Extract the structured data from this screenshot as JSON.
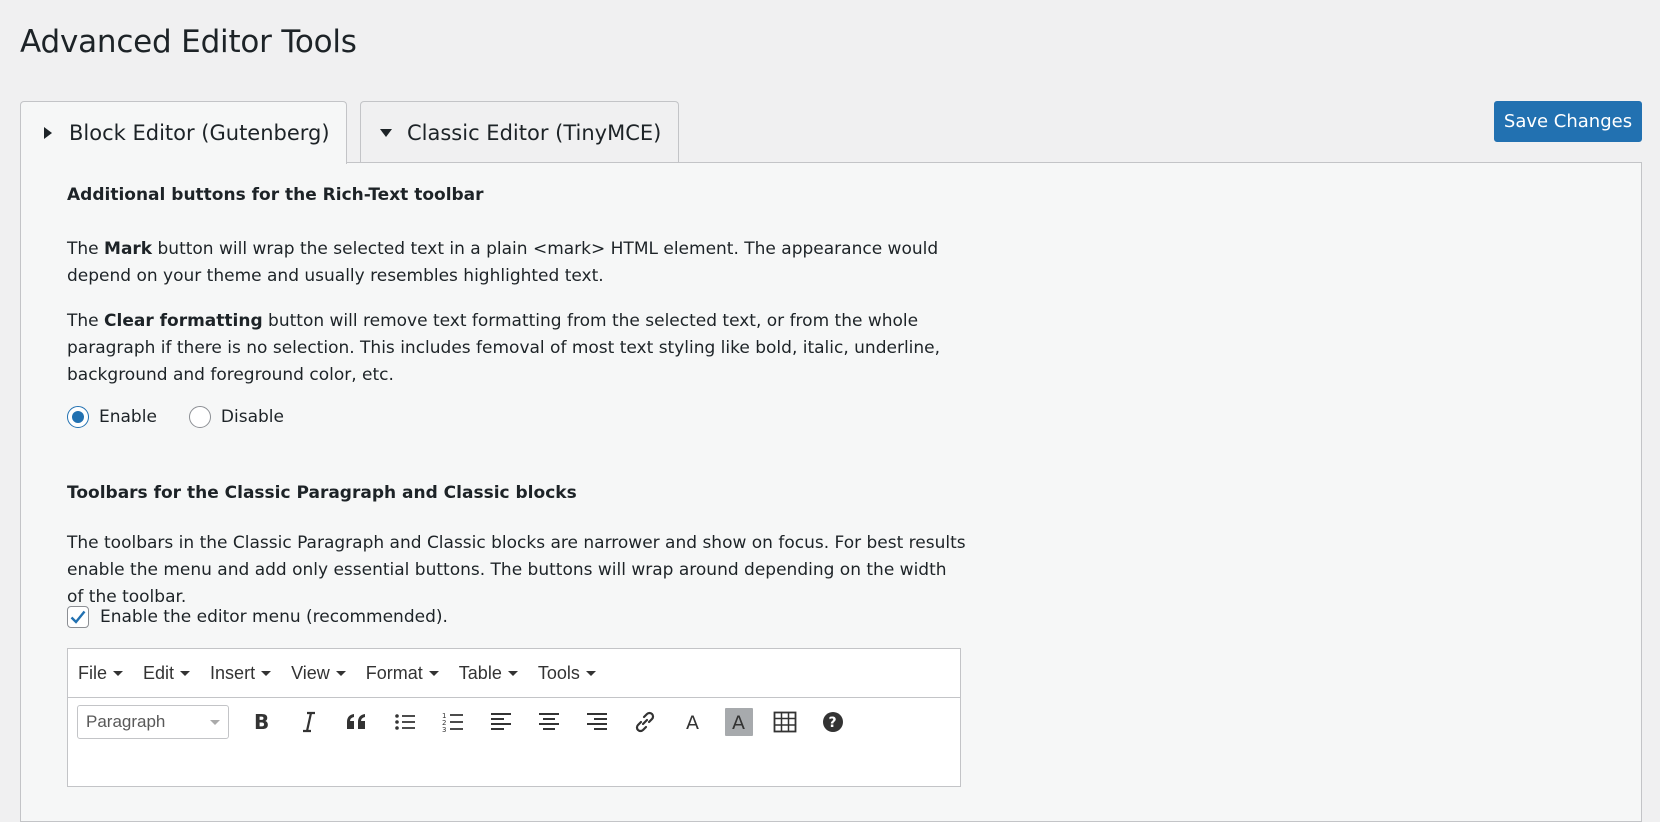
{
  "page_title": "Advanced Editor Tools",
  "tabs": [
    {
      "label": "Block Editor (Gutenberg)",
      "active": true
    },
    {
      "label": "Classic Editor (TinyMCE)",
      "active": false
    }
  ],
  "save_label": "Save Changes",
  "section1": {
    "heading": "Additional buttons for the Rich-Text toolbar",
    "p1": {
      "pre": "The ",
      "bold": "Mark",
      "post": " button will wrap the selected text in a plain <mark> HTML element. The appearance would depend on your theme and usually resembles highlighted text."
    },
    "p2": {
      "pre": "The ",
      "bold": "Clear formatting",
      "post": " button will remove text formatting from the selected text, or from the whole paragraph if there is no selection. This includes femoval of most text styling like bold, italic, underline, background and foreground color, etc."
    },
    "radio_enable": "Enable",
    "radio_disable": "Disable",
    "selected": "Enable"
  },
  "section2": {
    "heading": "Toolbars for the Classic Paragraph and Classic blocks",
    "p1": "The toolbars in the Classic Paragraph and Classic blocks are narrower and show on focus. For best results enable the menu and add only essential buttons. The buttons will wrap around depending on the width of the toolbar.",
    "checkbox_label": "Enable the editor menu (recommended).",
    "checkbox_checked": true
  },
  "editor": {
    "menu": [
      "File",
      "Edit",
      "Insert",
      "View",
      "Format",
      "Table",
      "Tools"
    ],
    "format_select": "Paragraph",
    "toolbar_icons": [
      "bold-icon",
      "italic-icon",
      "blockquote-icon",
      "bullet-list-icon",
      "numbered-list-icon",
      "align-left-icon",
      "align-center-icon",
      "align-right-icon",
      "link-icon",
      "text-color-icon",
      "background-color-icon",
      "table-icon",
      "help-icon"
    ]
  },
  "colors": {
    "primary": "#2271b1",
    "background": "#f0f0f1",
    "panel": "#f6f7f7",
    "border": "#c3c4c7"
  }
}
